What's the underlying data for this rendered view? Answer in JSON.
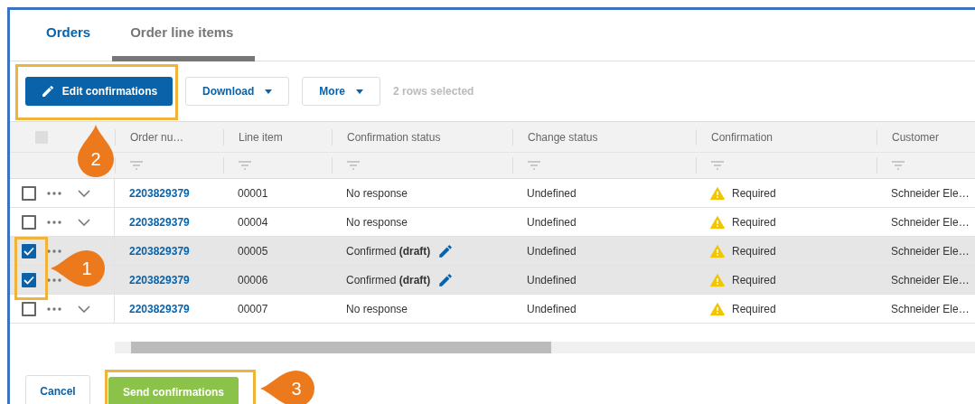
{
  "tabs": [
    {
      "label": "Orders",
      "selected": false
    },
    {
      "label": "Order line items",
      "selected": true
    }
  ],
  "toolbar": {
    "edit_button": "Edit confirmations",
    "download_button": "Download",
    "more_button": "More",
    "selection_info": "2 rows selected"
  },
  "table": {
    "select_all": {
      "disabled": true
    },
    "columns": [
      "Order nu…",
      "Line item",
      "Confirmation status",
      "Change status",
      "Confirmation",
      "Customer"
    ],
    "rows": [
      {
        "selected": false,
        "order": "2203829379",
        "line_item": "00001",
        "confirmation_status": "No response",
        "editable": false,
        "change_status": "Undefined",
        "confirmation": "Required",
        "customer": "Schneider Ele…"
      },
      {
        "selected": false,
        "order": "2203829379",
        "line_item": "00004",
        "confirmation_status": "No response",
        "editable": false,
        "change_status": "Undefined",
        "confirmation": "Required",
        "customer": "Schneider Ele…"
      },
      {
        "selected": true,
        "order": "2203829379",
        "line_item": "00005",
        "confirmation_status": "Confirmed **(draft)**",
        "editable": true,
        "change_status": "Undefined",
        "confirmation": "Required",
        "customer": "Schneider Ele…"
      },
      {
        "selected": true,
        "order": "2203829379",
        "line_item": "00006",
        "confirmation_status": "Confirmed **(draft)**",
        "editable": true,
        "change_status": "Undefined",
        "confirmation": "Required",
        "customer": "Schneider Ele…"
      },
      {
        "selected": false,
        "order": "2203829379",
        "line_item": "00007",
        "confirmation_status": "No response",
        "editable": false,
        "change_status": "Undefined",
        "confirmation": "Required",
        "customer": "Schneider Ele…"
      }
    ]
  },
  "footer": {
    "cancel_button": "Cancel",
    "send_button": "Send confirmations"
  },
  "callouts": [
    {
      "number": "2",
      "kind": "drop"
    },
    {
      "number": "1",
      "kind": "pointer"
    },
    {
      "number": "3",
      "kind": "pointer"
    }
  ]
}
